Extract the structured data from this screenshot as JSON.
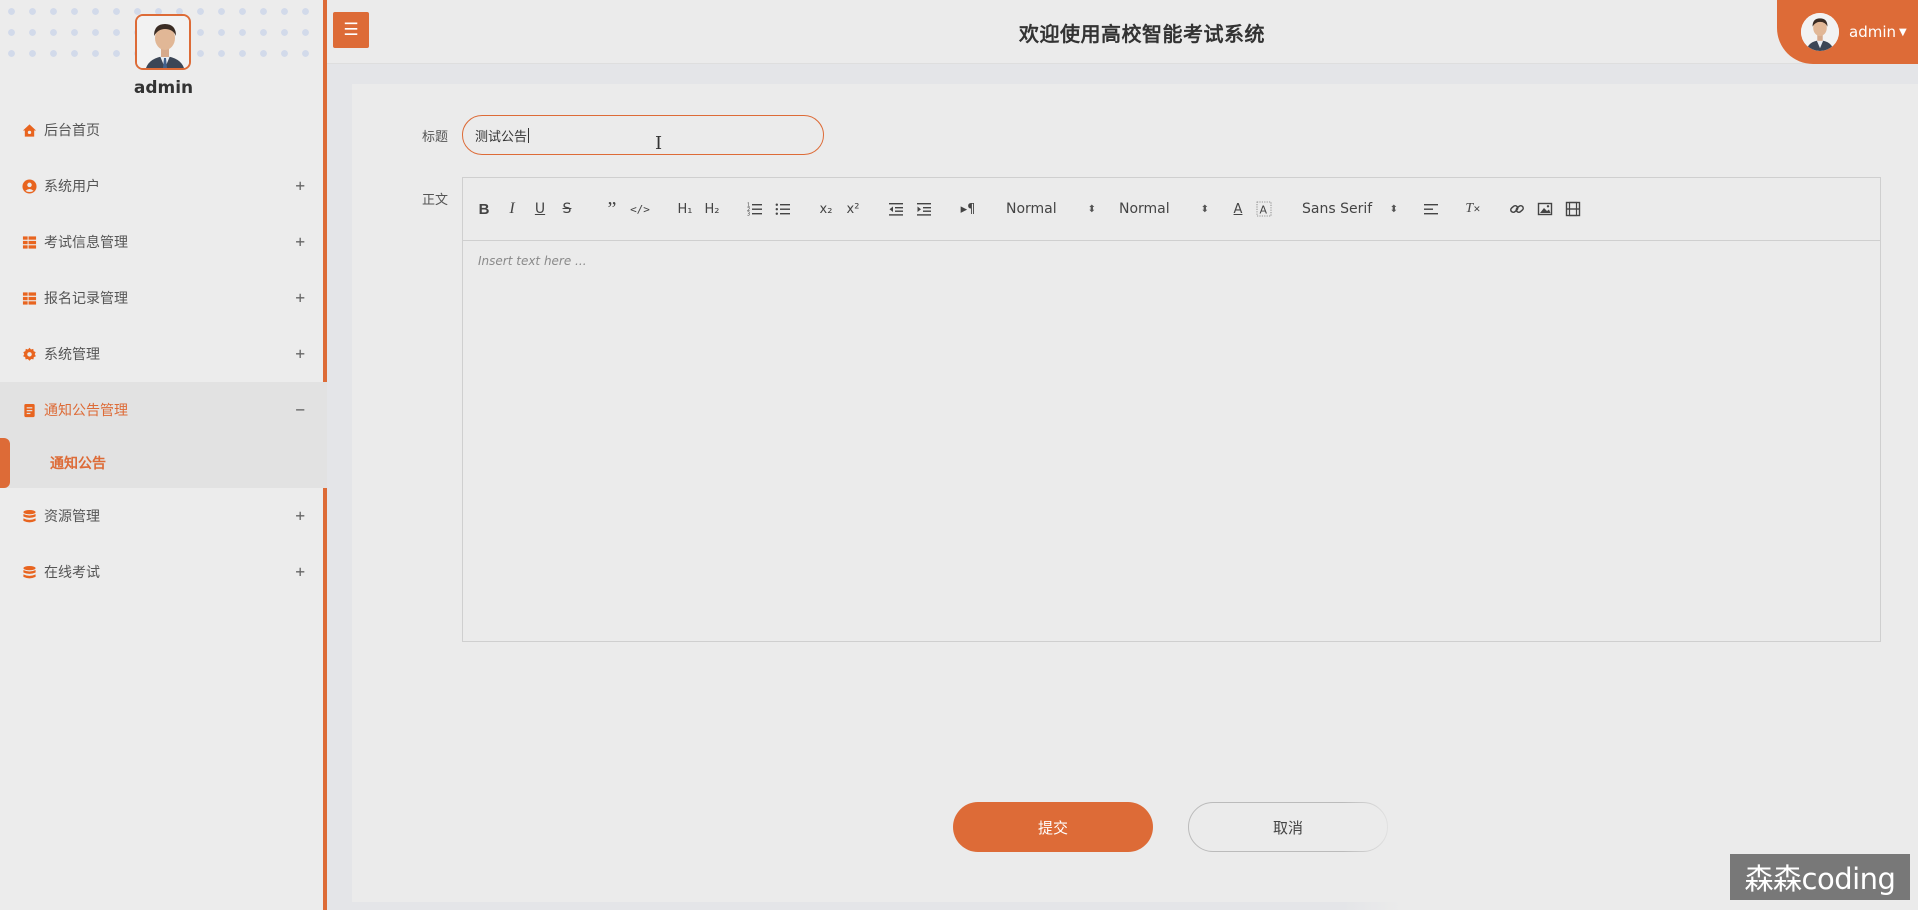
{
  "sidebar": {
    "username": "admin",
    "items": [
      {
        "label": "后台首页",
        "icon": "home-icon",
        "toggle": ""
      },
      {
        "label": "系统用户",
        "icon": "user-circle-icon",
        "toggle": "+"
      },
      {
        "label": "考试信息管理",
        "icon": "grid-icon",
        "toggle": "+"
      },
      {
        "label": "报名记录管理",
        "icon": "grid-icon",
        "toggle": "+"
      },
      {
        "label": "系统管理",
        "icon": "gear-icon",
        "toggle": "+"
      },
      {
        "label": "通知公告管理",
        "icon": "document-icon",
        "toggle": "−"
      },
      {
        "label": "资源管理",
        "icon": "database-icon",
        "toggle": "+"
      },
      {
        "label": "在线考试",
        "icon": "database-icon",
        "toggle": "+"
      }
    ],
    "sub_item": {
      "label": "通知公告"
    }
  },
  "header": {
    "menu_icon": "☰",
    "title": "欢迎使用高校智能考试系统",
    "user": "admin"
  },
  "form": {
    "title_label": "标题",
    "title_value": "测试公告",
    "content_label": "正文",
    "placeholder": "Insert text here ...",
    "header_select": "Normal",
    "size_select": "Normal",
    "font_select": "Sans Serif",
    "submit_label": "提交",
    "cancel_label": "取消"
  },
  "watermark": "森森coding",
  "colors": {
    "accent": "#dd6b37",
    "background": "#ebebeb"
  }
}
